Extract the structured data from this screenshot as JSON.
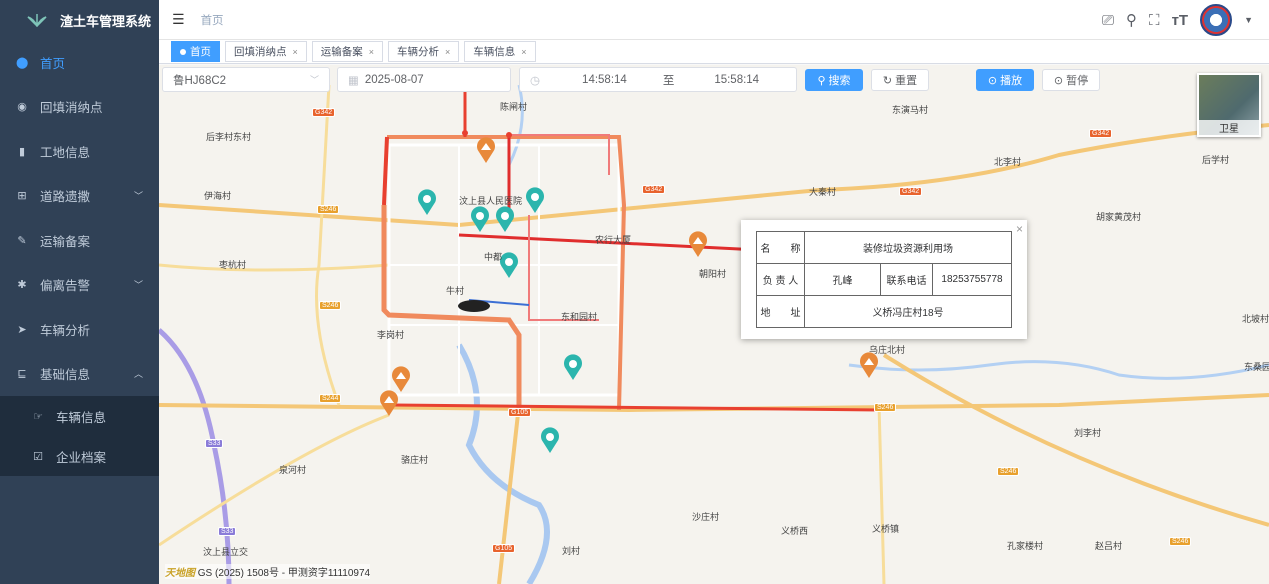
{
  "app": {
    "title": "渣土车管理系统"
  },
  "sidebar": {
    "items": [
      {
        "label": "首页",
        "icon": "dashboard-icon",
        "active": true
      },
      {
        "label": "回填消纳点",
        "icon": "location-icon"
      },
      {
        "label": "工地信息",
        "icon": "bar-chart-icon"
      },
      {
        "label": "道路遗撒",
        "icon": "table-icon",
        "expandable": true
      },
      {
        "label": "运输备案",
        "icon": "edit-icon"
      },
      {
        "label": "偏离告警",
        "icon": "bug-icon",
        "expandable": true
      },
      {
        "label": "车辆分析",
        "icon": "send-icon"
      },
      {
        "label": "基础信息",
        "icon": "tree-icon",
        "expanded": true
      }
    ],
    "subitems": [
      {
        "label": "车辆信息",
        "icon": "car-icon"
      },
      {
        "label": "企业档案",
        "icon": "archive-icon"
      }
    ]
  },
  "header": {
    "breadcrumb": "首页"
  },
  "tags": [
    {
      "label": "首页",
      "active": true
    },
    {
      "label": "回填消纳点"
    },
    {
      "label": "运输备案"
    },
    {
      "label": "车辆分析"
    },
    {
      "label": "车辆信息"
    }
  ],
  "toolbar": {
    "plate": "鲁HJ68C2",
    "date": "2025-08-07",
    "start_time": "14:58:14",
    "to": "至",
    "end_time": "15:58:14",
    "search": "搜索",
    "reset": "重置",
    "play": "播放",
    "pause": "暂停"
  },
  "map": {
    "satellite_label": "卫星",
    "copyright": "GS (2025) 1508号 - 甲测资字11110974",
    "places": [
      "东演马村",
      "北李村",
      "后学村",
      "胡家黄茂村",
      "大秦村",
      "后李村东村",
      "伊海村",
      "枣杭村",
      "朝阳村",
      "牛村",
      "东和园村",
      "李岗村",
      "乌庄北村",
      "刘李村",
      "北坡村",
      "东桑园",
      "泉河村",
      "骆庄村",
      "沙庄村",
      "义桥西",
      "义桥镇",
      "孔家楼村",
      "赵吕村",
      "刘村",
      "汶上县立交",
      "陈闸村",
      "汶上县人民医院",
      "中都",
      "农行大厦"
    ],
    "roads": [
      "G342",
      "G342",
      "G342",
      "G342",
      "S246",
      "S246",
      "S246",
      "S246",
      "S244",
      "G105",
      "G105",
      "S33",
      "S33",
      "S246"
    ]
  },
  "popup": {
    "name_label": "名　　称",
    "name_value": "装修垃圾资源利用场",
    "person_label": "负 责 人",
    "person_value": "孔峰",
    "phone_label": "联系电话",
    "phone_value": "18253755778",
    "address_label": "地　　址",
    "address_value": "义桥冯庄村18号"
  }
}
